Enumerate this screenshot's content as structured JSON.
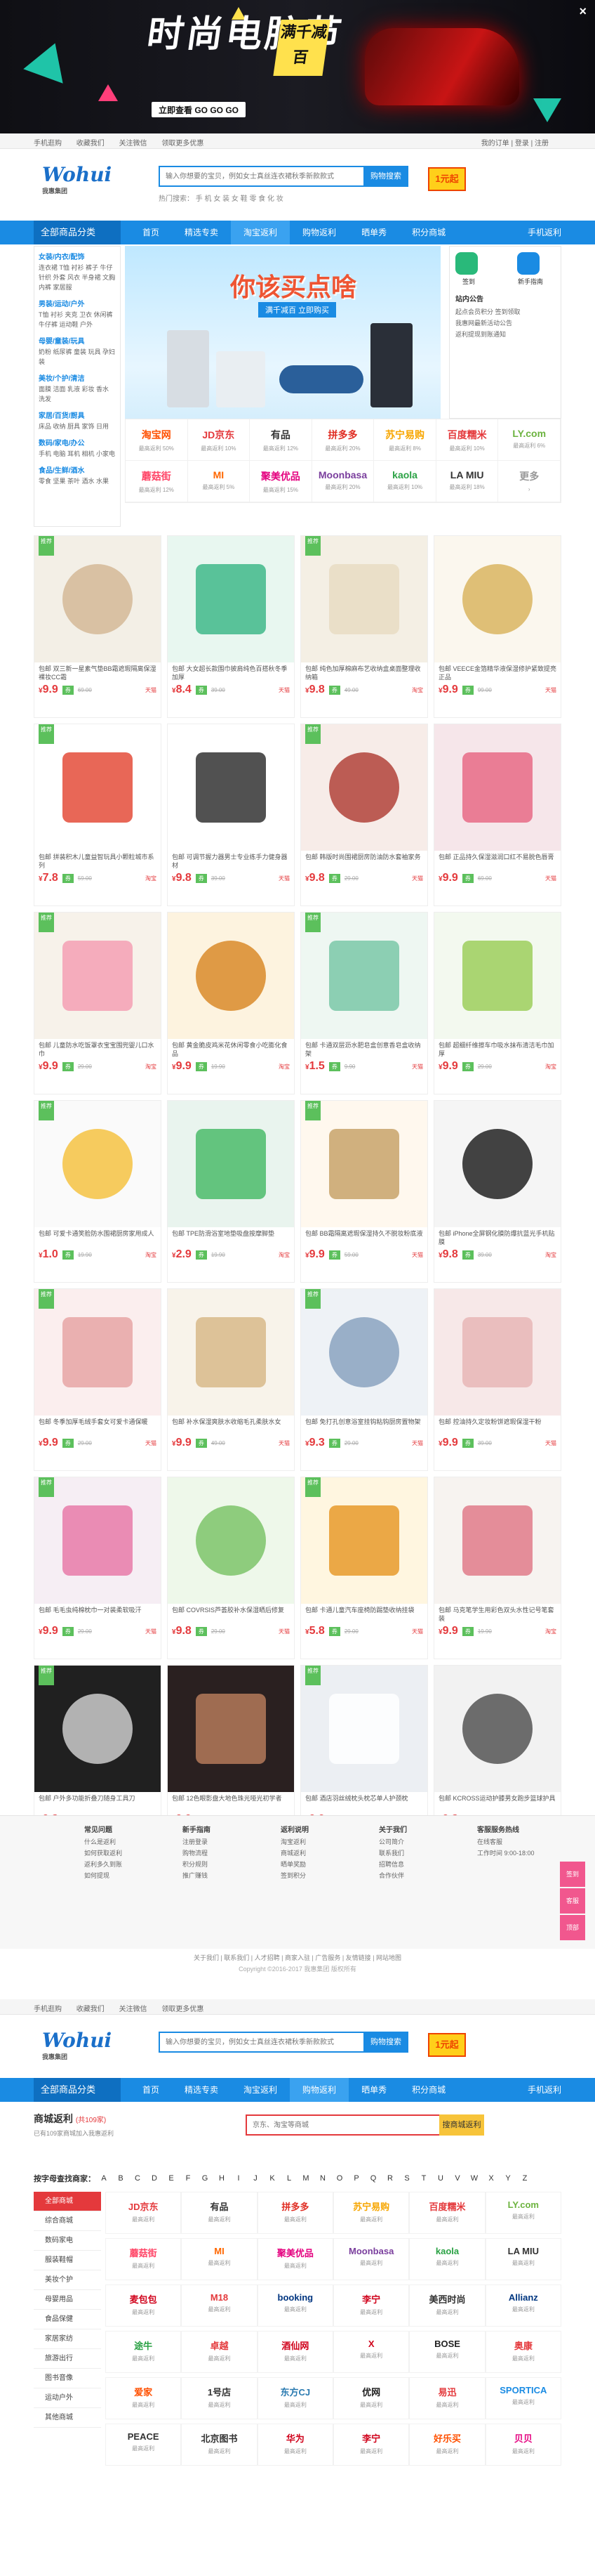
{
  "banner": {
    "title": "时尚电脑节",
    "sub": "满千减百",
    "go": "立即查看 GO GO GO",
    "close": "×"
  },
  "topbar": {
    "items": [
      "手机逛购",
      "收藏我们",
      "关注微信",
      "领取更多优惠"
    ],
    "right": "我的订单 | 登录 | 注册"
  },
  "header": {
    "logo": "Wohui",
    "logo_sub": "我惠集团",
    "search_placeholder": "输入你想要的宝贝，例如女士真丝连衣裙秋季新款款式",
    "search_btn": "购物搜索",
    "hot": "热门搜索： 手 机 女 装 女 鞋 零 食 化 妆",
    "badge": "1元起"
  },
  "nav": {
    "category": "全部商品分类",
    "items": [
      "首页",
      "精选专卖",
      "淘宝返利",
      "购物返利",
      "晒单秀",
      "积分商城"
    ],
    "app": "手机返利"
  },
  "sidemenu": [
    {
      "h": "女装/内衣/配饰",
      "l": "连衣裙 T恤 衬衫 裤子 牛仔 针织 外套 风衣 半身裙 文胸 内裤 家居服"
    },
    {
      "h": "男装/运动/户外",
      "l": "T恤 衬衫 夹克 卫衣 休闲裤 牛仔裤 运动鞋 户外"
    },
    {
      "h": "母婴/童装/玩具",
      "l": "奶粉 纸尿裤 童装 玩具 孕妇装"
    },
    {
      "h": "美妆/个护/清洁",
      "l": "面膜 洁面 乳液 彩妆 香水 洗发"
    },
    {
      "h": "家居/百货/厨具",
      "l": "床品 收纳 厨具 家饰 日用"
    },
    {
      "h": "数码/家电/办公",
      "l": "手机 电脑 耳机 相机 小家电"
    },
    {
      "h": "食品/生鲜/酒水",
      "l": "零食 坚果 茶叶 酒水 水果"
    }
  ],
  "promo": {
    "title": "你该买点啥",
    "sub": "满千减百 立即购买"
  },
  "rightpanel": {
    "signin": "签到",
    "newbie": "新手指南",
    "notice": "站内公告",
    "lines": [
      "起点会员积分 签到领取",
      "我惠网最新活动公告",
      "返利提现到账通知"
    ]
  },
  "malls": [
    {
      "n": "淘宝网",
      "r": "最高返利 50%",
      "c": "#ff5000"
    },
    {
      "n": "JD京东",
      "r": "最高返利 10%",
      "c": "#e4393c"
    },
    {
      "n": "有品",
      "r": "最高返利 12%",
      "c": "#333"
    },
    {
      "n": "拼多多",
      "r": "最高返利 20%",
      "c": "#e02e24"
    },
    {
      "n": "苏宁易购",
      "r": "最高返利 8%",
      "c": "#f7a600"
    },
    {
      "n": "百度糯米",
      "r": "最高返利 10%",
      "c": "#e4393c"
    },
    {
      "n": "LY.com",
      "r": "最高返利 6%",
      "c": "#6cb33f"
    },
    {
      "n": "蘑菇街",
      "r": "最高返利 12%",
      "c": "#ff4466"
    },
    {
      "n": "MI",
      "r": "最高返利 5%",
      "c": "#ff6700"
    },
    {
      "n": "聚美优品",
      "r": "最高返利 15%",
      "c": "#e4007f"
    },
    {
      "n": "Moonbasa",
      "r": "最高返利 20%",
      "c": "#7a3e9d"
    },
    {
      "n": "kaola",
      "r": "最高返利 10%",
      "c": "#2ba245"
    },
    {
      "n": "LA MIU",
      "r": "最高返利 18%",
      "c": "#333"
    },
    {
      "n": "更多",
      "r": "›",
      "c": "#999"
    }
  ],
  "products": [
    {
      "t": "包邮 双三新一星素气垫BB霜遮瑕隔离保湿裸妆CC霜",
      "p": "9.9",
      "o": "69.00",
      "s": "天猫",
      "bg": "#f3efe6",
      "a": "#d4b896"
    },
    {
      "t": "包邮 大女超长款围巾披肩纯色百搭秋冬季加厚",
      "p": "8.4",
      "o": "39.00",
      "s": "天猫",
      "bg": "#e8f7f0",
      "a": "#3fb98a"
    },
    {
      "t": "包邮 纯色加厚棉麻布艺收纳盒桌面整理收纳箱",
      "p": "9.8",
      "o": "49.00",
      "s": "淘宝",
      "bg": "#f4efe4",
      "a": "#e8dcc3"
    },
    {
      "t": "包邮 VEECE金箔精华液保湿修护紧致提亮正品",
      "p": "9.9",
      "o": "99.00",
      "s": "天猫",
      "bg": "#fbf7ee",
      "a": "#d9b560"
    },
    {
      "t": "包邮 拼装积木儿童益智玩具小颗粒城市系列",
      "p": "7.8",
      "o": "59.00",
      "s": "淘宝",
      "bg": "#ffffff",
      "a": "#e44c3a"
    },
    {
      "t": "包邮 可调节握力器男士专业练手力健身器材",
      "p": "9.8",
      "o": "39.00",
      "s": "天猫",
      "bg": "#ffffff",
      "a": "#333333"
    },
    {
      "t": "包邮 韩版时尚围裙厨房防油防水套袖家务",
      "p": "9.8",
      "o": "29.00",
      "s": "天猫",
      "bg": "#f7ece8",
      "a": "#b2433a"
    },
    {
      "t": "包邮 正品持久保湿滋润口红不易脱色唇膏",
      "p": "9.9",
      "o": "69.00",
      "s": "天猫",
      "bg": "#f6e6ea",
      "a": "#e86a86"
    },
    {
      "t": "包邮 儿童防水吃饭罩衣宝宝围兜婴儿口水巾",
      "p": "9.9",
      "o": "29.00",
      "s": "淘宝",
      "bg": "#f7f2ea",
      "a": "#f4a0b4"
    },
    {
      "t": "包邮 黄金脆皮鸡米花休闲零食小吃膨化食品",
      "p": "9.9",
      "o": "19.90",
      "s": "淘宝",
      "bg": "#fdf3df",
      "a": "#d98a2a"
    },
    {
      "t": "包邮 卡通双层沥水肥皂盒创意香皂盒收纳架",
      "p": "1.5",
      "o": "9.90",
      "s": "天猫",
      "bg": "#eef7f2",
      "a": "#7ac8a8"
    },
    {
      "t": "包邮 超细纤维擦车巾吸水抹布清洁毛巾加厚",
      "p": "9.9",
      "o": "29.00",
      "s": "淘宝",
      "bg": "#f3f9ef",
      "a": "#9ccf5c"
    },
    {
      "t": "包邮 可爱卡通笑脸防水围裙厨房家用成人",
      "p": "1.0",
      "o": "19.90",
      "s": "淘宝",
      "bg": "#fafafa",
      "a": "#f4c242"
    },
    {
      "t": "包邮 TPE防滑浴室地垫吸盘按摩脚垫",
      "p": "2.9",
      "o": "19.90",
      "s": "淘宝",
      "bg": "#e9f4ee",
      "a": "#4bbb6a"
    },
    {
      "t": "包邮 BB霜隔离遮瑕保湿持久不脱妆粉底液",
      "p": "9.9",
      "o": "59.00",
      "s": "天猫",
      "bg": "#fff8ee",
      "a": "#c8a36a"
    },
    {
      "t": "包邮 iPhone全屏钢化膜防爆抗蓝光手机贴膜",
      "p": "9.8",
      "o": "39.00",
      "s": "淘宝",
      "bg": "#f5f5f5",
      "a": "#222222"
    },
    {
      "t": "包邮 冬季加厚毛绒手套女可爱卡通保暖",
      "p": "9.9",
      "o": "29.00",
      "s": "天猫",
      "bg": "#fbeeee",
      "a": "#e6a4a4"
    },
    {
      "t": "包邮 补水保湿爽肤水收缩毛孔柔肤水女",
      "p": "9.9",
      "o": "49.00",
      "s": "天猫",
      "bg": "#f8f3ea",
      "a": "#d8b98a"
    },
    {
      "t": "包邮 免打孔创意浴室挂钩粘钩厨房置物架",
      "p": "9.3",
      "o": "29.00",
      "s": "天猫",
      "bg": "#eef2f6",
      "a": "#8aa3bf"
    },
    {
      "t": "包邮 控油持久定妆粉饼遮瑕保湿干粉",
      "p": "9.9",
      "o": "39.00",
      "s": "天猫",
      "bg": "#f7e8e8",
      "a": "#e8b6b6"
    },
    {
      "t": "包邮 毛毛虫纯棉枕巾一对装柔软吸汗",
      "p": "9.9",
      "o": "29.00",
      "s": "天猫",
      "bg": "#f6eef4",
      "a": "#e87aa8"
    },
    {
      "t": "包邮 COVRSIS芦荟胶补水保湿晒后修复",
      "p": "9.8",
      "o": "29.00",
      "s": "天猫",
      "bg": "#eef8ea",
      "a": "#7dc46a"
    },
    {
      "t": "包邮 卡通儿童汽车座椅防踢垫收纳挂袋",
      "p": "5.8",
      "o": "29.00",
      "s": "天猫",
      "bg": "#fff6e0",
      "a": "#e89a2a"
    },
    {
      "t": "包邮 马克笔学生用彩色双头水性记号笔套装",
      "p": "9.9",
      "o": "19.90",
      "s": "淘宝",
      "bg": "#f7f3f0",
      "a": "#e07a8a"
    },
    {
      "t": "包邮 户外多功能折叠刀随身工具刀",
      "p": "9.8",
      "o": "49.00",
      "s": "淘宝",
      "bg": "#202020",
      "a": "#cccccc"
    },
    {
      "t": "包邮 12色眼影盘大地色珠光哑光初学者",
      "p": "9.9",
      "o": "39.00",
      "s": "天猫",
      "bg": "#2a2020",
      "a": "#b47a5a"
    },
    {
      "t": "包邮 酒店羽丝绒枕头枕芯单人护颈枕",
      "p": "9.9",
      "o": "59.00",
      "s": "天猫",
      "bg": "#eceff3",
      "a": "#ffffff"
    },
    {
      "t": "包邮 KCROSS运动护膝男女跑步篮球护具",
      "p": "9.8",
      "o": "39.00",
      "s": "淘宝",
      "bg": "#f2f2f2",
      "a": "#555555"
    }
  ],
  "footer": {
    "cols": [
      {
        "h": "常见问题",
        "l": [
          "什么是返利",
          "如何获取返利",
          "返利多久到账",
          "如何提现"
        ]
      },
      {
        "h": "新手指南",
        "l": [
          "注册登录",
          "购物流程",
          "积分规则",
          "推广赚钱"
        ]
      },
      {
        "h": "返利说明",
        "l": [
          "淘宝返利",
          "商城返利",
          "晒单奖励",
          "签到积分"
        ]
      },
      {
        "h": "关于我们",
        "l": [
          "公司简介",
          "联系我们",
          "招聘信息",
          "合作伙伴"
        ]
      },
      {
        "h": "客服服务热线",
        "l": [
          "在线客服",
          "工作时间 9:00-18:00"
        ]
      }
    ],
    "links": "关于我们 | 联系我们 | 人才招聘 | 商家入驻 | 广告服务 | 友情链接 | 网站地图",
    "copy": "Copyright ©2016-2017 我惠集团 版权所有"
  },
  "sidebtns": [
    "签到",
    "客服",
    "顶部"
  ],
  "mallpage": {
    "title": "商城返利",
    "count": "(共109家)",
    "breadcrumb": "已有109家商城加入我惠返利",
    "search_placeholder": "京东、淘宝等商城",
    "search_btn": "搜商城返利",
    "letters_label": "按字母查找商家：",
    "letters": [
      "A",
      "B",
      "C",
      "D",
      "E",
      "F",
      "G",
      "H",
      "I",
      "J",
      "K",
      "L",
      "M",
      "N",
      "O",
      "P",
      "Q",
      "R",
      "S",
      "T",
      "U",
      "V",
      "W",
      "X",
      "Y",
      "Z"
    ],
    "cats": [
      "全部商城",
      "综合商城",
      "数码家电",
      "服装鞋帽",
      "美妆个护",
      "母婴用品",
      "食品保健",
      "家居家纺",
      "旅游出行",
      "图书音像",
      "运动户外",
      "其他商城"
    ],
    "grid": [
      {
        "n": "JD京东",
        "c": "#e4393c"
      },
      {
        "n": "有品",
        "c": "#333"
      },
      {
        "n": "拼多多",
        "c": "#e02e24"
      },
      {
        "n": "苏宁易购",
        "c": "#f7a600"
      },
      {
        "n": "百度糯米",
        "c": "#e4393c"
      },
      {
        "n": "LY.com",
        "c": "#6cb33f"
      },
      {
        "n": "蘑菇街",
        "c": "#ff4466"
      },
      {
        "n": "MI",
        "c": "#ff6700"
      },
      {
        "n": "聚美优品",
        "c": "#e4007f"
      },
      {
        "n": "Moonbasa",
        "c": "#7a3e9d"
      },
      {
        "n": "kaola",
        "c": "#2ba245"
      },
      {
        "n": "LA MIU",
        "c": "#333"
      },
      {
        "n": "麦包包",
        "c": "#d0021b"
      },
      {
        "n": "M18",
        "c": "#e4393c"
      },
      {
        "n": "booking",
        "c": "#003580"
      },
      {
        "n": "李宁",
        "c": "#d0021b"
      },
      {
        "n": "美西时尚",
        "c": "#333"
      },
      {
        "n": "Allianz",
        "c": "#003781"
      },
      {
        "n": "途牛",
        "c": "#2ba245"
      },
      {
        "n": "卓越",
        "c": "#e4393c"
      },
      {
        "n": "酒仙网",
        "c": "#d0021b"
      },
      {
        "n": "X",
        "c": "#d0021b"
      },
      {
        "n": "BOSE",
        "c": "#222"
      },
      {
        "n": "奥康",
        "c": "#e4393c"
      },
      {
        "n": "爱家",
        "c": "#ff5000"
      },
      {
        "n": "1号店",
        "c": "#333"
      },
      {
        "n": "东方CJ",
        "c": "#2a7ab0"
      },
      {
        "n": "优网",
        "c": "#222"
      },
      {
        "n": "易迅",
        "c": "#e4393c"
      },
      {
        "n": "SPORTICA",
        "c": "#1a8be3"
      },
      {
        "n": "PEACE",
        "c": "#333"
      },
      {
        "n": "北京图书",
        "c": "#333"
      },
      {
        "n": "华为",
        "c": "#d0021b"
      },
      {
        "n": "李宁",
        "c": "#d0021b"
      },
      {
        "n": "好乐买",
        "c": "#ff5000"
      },
      {
        "n": "贝贝",
        "c": "#e4007f"
      }
    ]
  }
}
